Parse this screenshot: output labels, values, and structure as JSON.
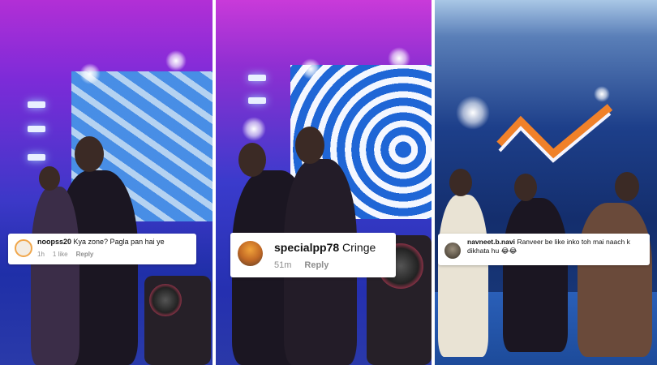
{
  "comments": [
    {
      "username": "noopss20",
      "text": "Kya zone? Pagla pan hai ye",
      "time": "1h",
      "likes": "1 like",
      "reply": "Reply"
    },
    {
      "username": "specialpp78",
      "text": "Cringe",
      "time": "51m",
      "reply": "Reply"
    },
    {
      "username": "navneet.b.navi",
      "text": "Ranveer be like inko toh mai naach k dikhata hu 😂😂"
    }
  ],
  "colors": {
    "comment_bg": "#ffffff",
    "meta_gray": "#8e8e8e",
    "divider": "#ffffff"
  }
}
